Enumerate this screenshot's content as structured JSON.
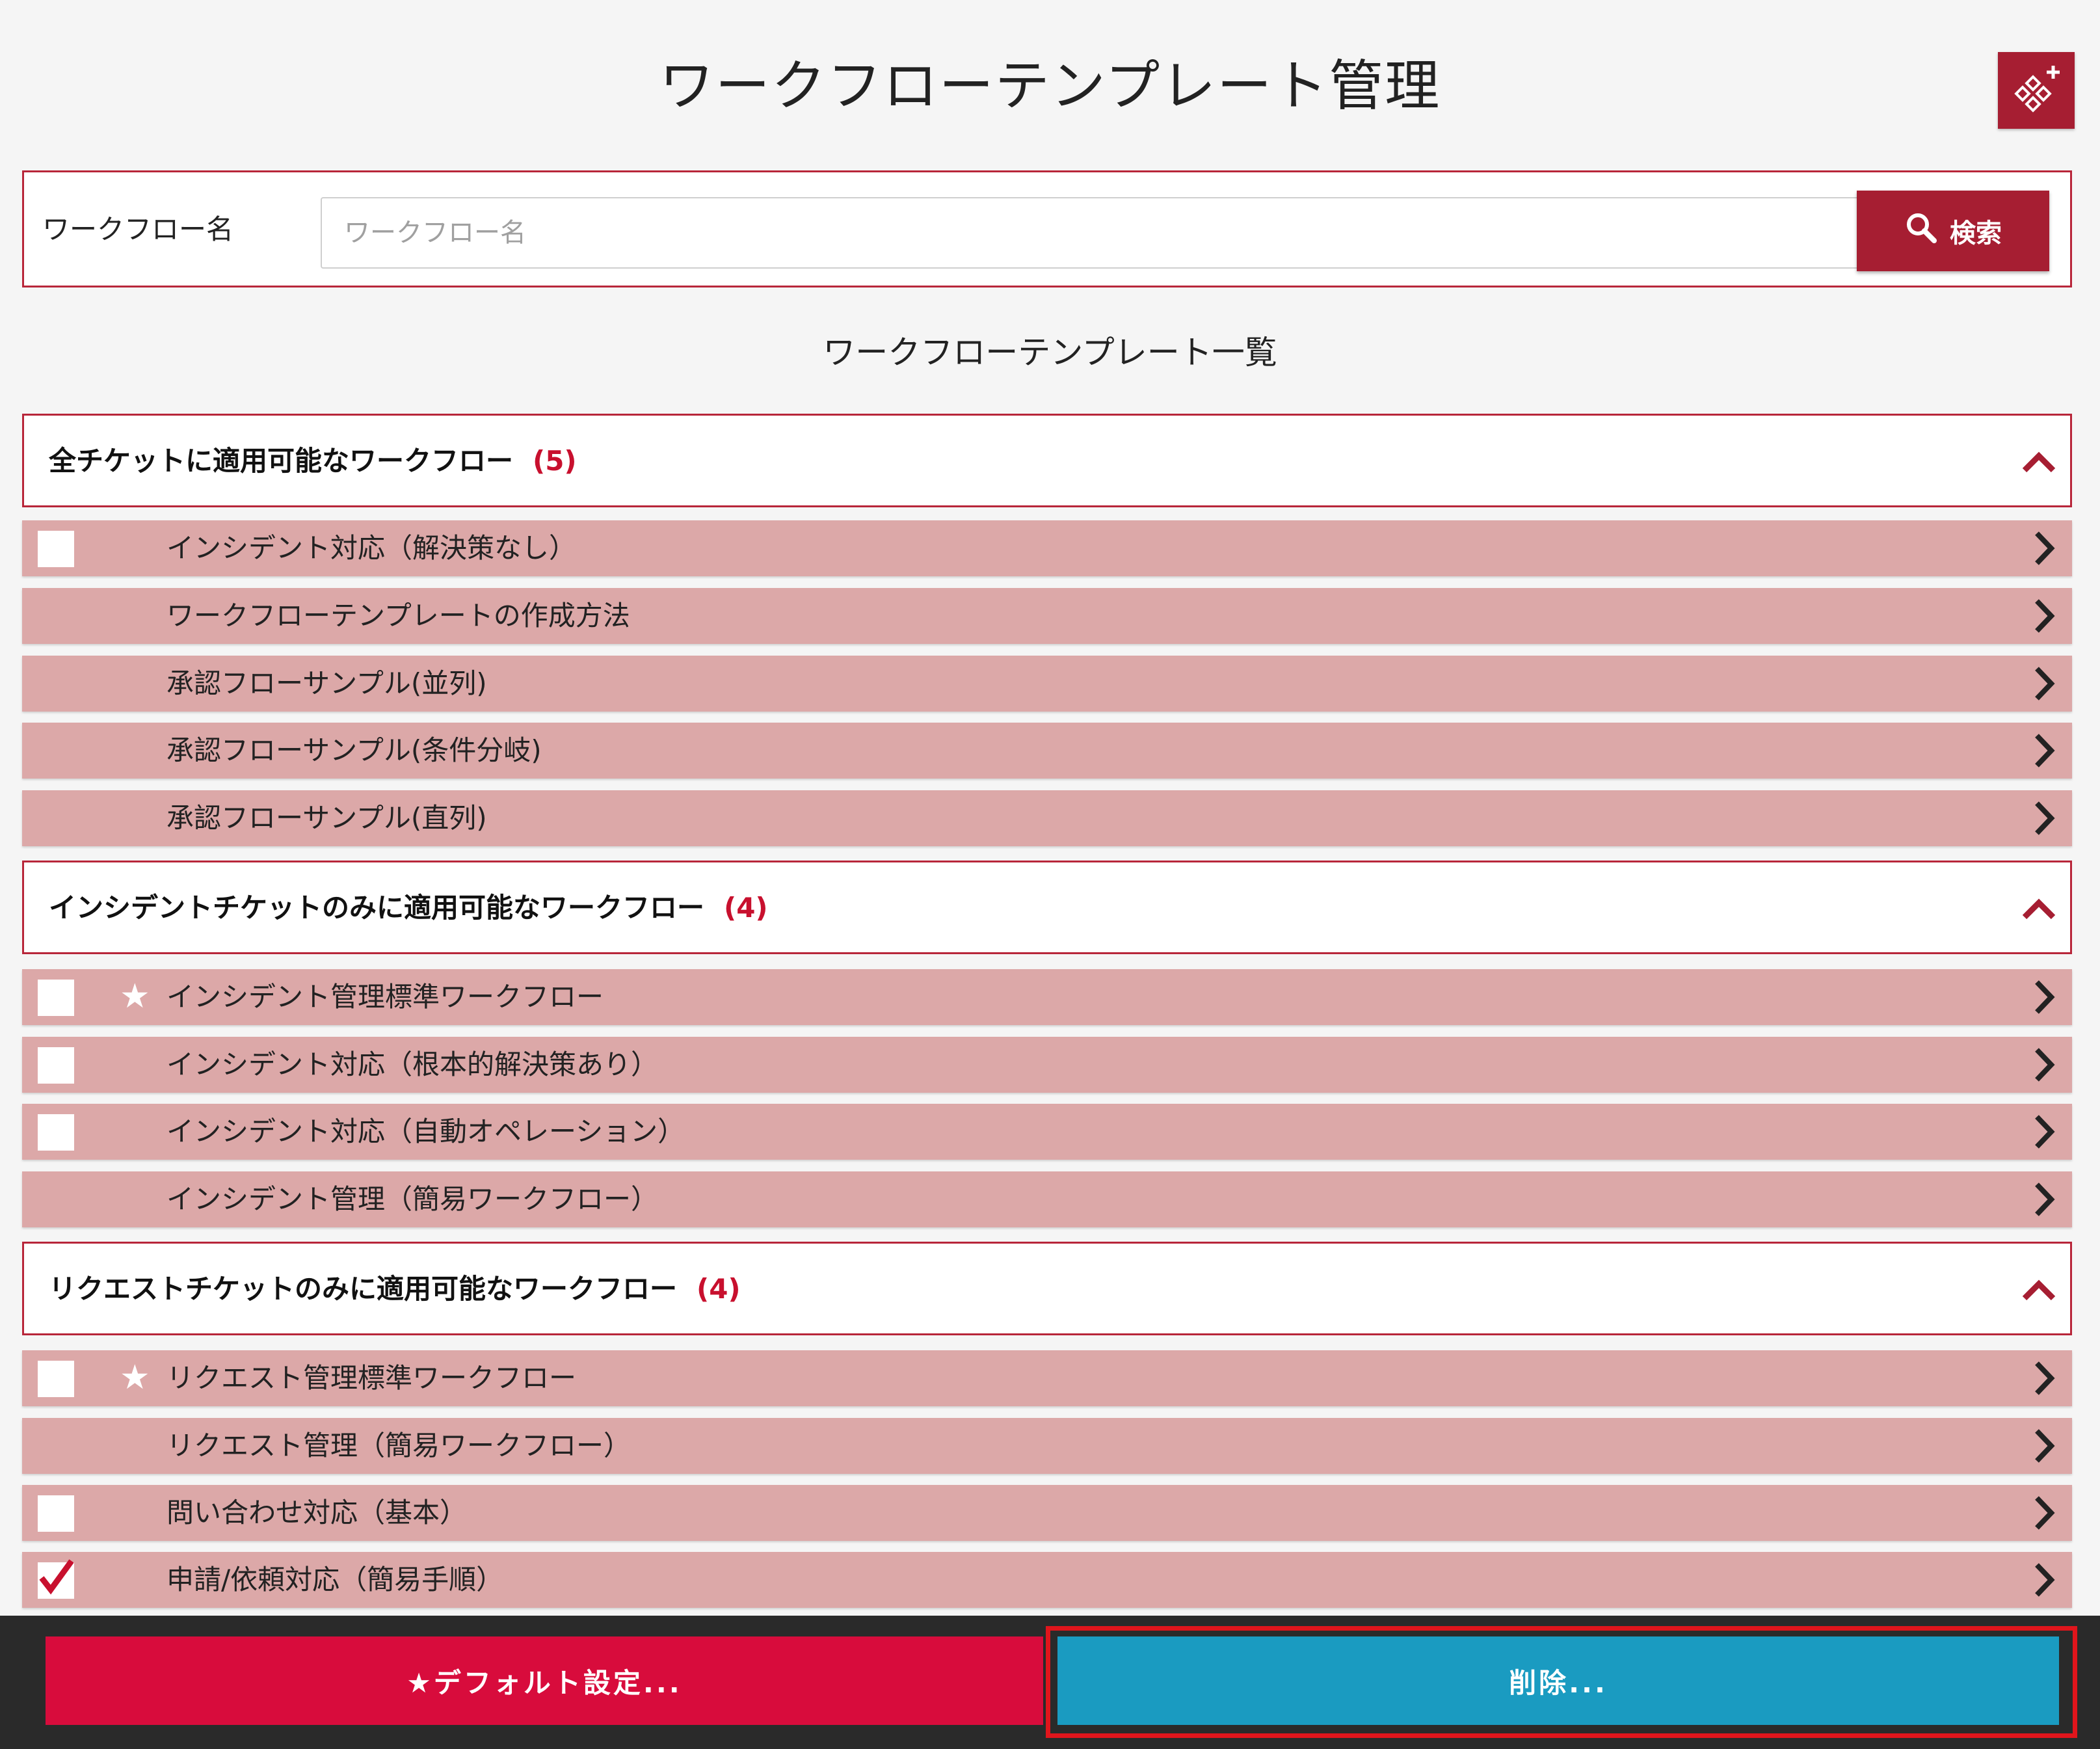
{
  "header": {
    "title": "ワークフローテンプレート管理",
    "add_icon": "workflow-add-icon"
  },
  "search": {
    "label": "ワークフロー名",
    "placeholder": "ワークフロー名",
    "value": "",
    "button_label": "検索",
    "button_icon": "search-icon"
  },
  "list": {
    "title": "ワークフローテンプレート一覧"
  },
  "sections": [
    {
      "title": "全チケットに適用可能なワークフロー",
      "count": "(5)",
      "items": [
        {
          "label": "インシデント対応（解決策なし）",
          "checkbox": true,
          "checked": false,
          "star": false
        },
        {
          "label": "ワークフローテンプレートの作成方法",
          "checkbox": false,
          "checked": false,
          "star": false
        },
        {
          "label": "承認フローサンプル(並列)",
          "checkbox": false,
          "checked": false,
          "star": false
        },
        {
          "label": "承認フローサンプル(条件分岐)",
          "checkbox": false,
          "checked": false,
          "star": false
        },
        {
          "label": "承認フローサンプル(直列)",
          "checkbox": false,
          "checked": false,
          "star": false
        }
      ]
    },
    {
      "title": "インシデントチケットのみに適用可能なワークフロー",
      "count": "(4)",
      "items": [
        {
          "label": "インシデント管理標準ワークフロー",
          "checkbox": true,
          "checked": false,
          "star": true
        },
        {
          "label": "インシデント対応（根本的解決策あり）",
          "checkbox": true,
          "checked": false,
          "star": false
        },
        {
          "label": "インシデント対応（自動オペレーション）",
          "checkbox": true,
          "checked": false,
          "star": false
        },
        {
          "label": "インシデント管理（簡易ワークフロー）",
          "checkbox": false,
          "checked": false,
          "star": false
        }
      ]
    },
    {
      "title": "リクエストチケットのみに適用可能なワークフロー",
      "count": "(4)",
      "items": [
        {
          "label": "リクエスト管理標準ワークフロー",
          "checkbox": true,
          "checked": false,
          "star": true
        },
        {
          "label": "リクエスト管理（簡易ワークフロー）",
          "checkbox": false,
          "checked": false,
          "star": false
        },
        {
          "label": "問い合わせ対応（基本）",
          "checkbox": true,
          "checked": false,
          "star": false
        },
        {
          "label": "申請/依頼対応（簡易手順）",
          "checkbox": true,
          "checked": true,
          "star": false
        }
      ]
    }
  ],
  "actions": {
    "default_label": "★デフォルト設定...",
    "delete_label": "削除..."
  },
  "colors": {
    "accent": "#a61e32",
    "section_border": "#b8263a",
    "row_background": "#dca8a8",
    "count": "#c8102e",
    "default_button": "#d80c3c",
    "delete_button": "#1a9bc1",
    "highlight": "#e0151c"
  }
}
